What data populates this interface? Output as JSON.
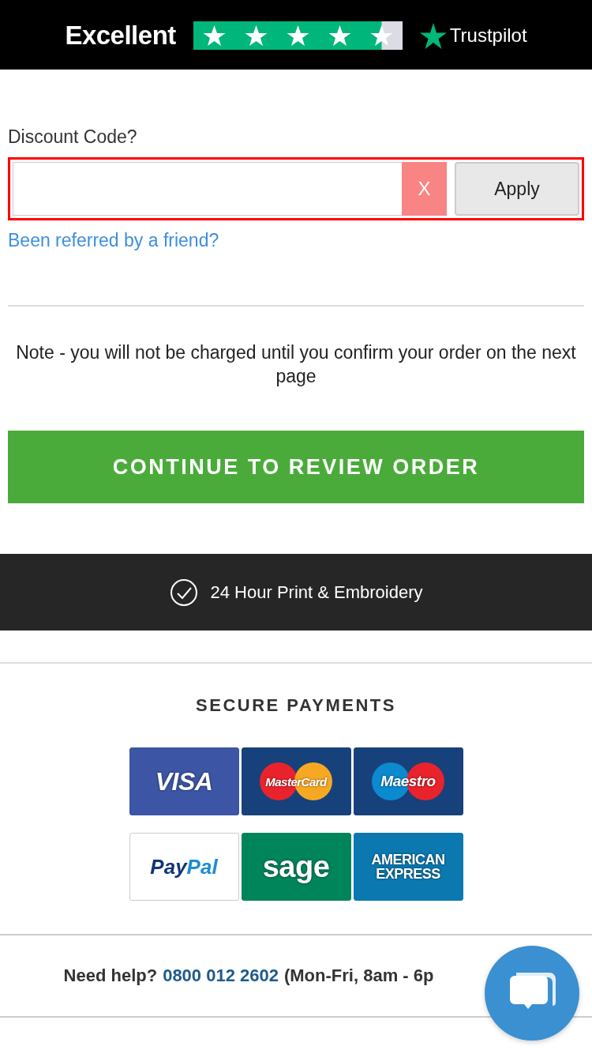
{
  "rating_bar": {
    "label": "Excellent",
    "stars": 4.5,
    "brand": "Trustpilot"
  },
  "discount": {
    "label": "Discount Code?",
    "clear_button": "X",
    "apply_button": "Apply",
    "error": true
  },
  "referral_link": "Been referred by a friend?",
  "note": "Note - you will not be charged until you confirm your order on the next page",
  "continue_button": "CONTINUE TO REVIEW ORDER",
  "feature_band": {
    "text": "24 Hour Print & Embroidery"
  },
  "payments": {
    "title": "SECURE PAYMENTS",
    "cards": [
      {
        "kind": "visa",
        "label": "VISA"
      },
      {
        "kind": "mastercard",
        "label": "MasterCard"
      },
      {
        "kind": "maestro",
        "label": "Maestro"
      },
      {
        "kind": "paypal",
        "label": "Pay",
        "label_2": "Pal"
      },
      {
        "kind": "sage",
        "label": "sage"
      },
      {
        "kind": "amex",
        "label": "AMERICAN",
        "label_2": "EXPRESS"
      }
    ]
  },
  "help": {
    "prefix": "Need help?",
    "phone": "0800 012 2602",
    "suffix": "(Mon-Fri, 8am - 6p"
  }
}
